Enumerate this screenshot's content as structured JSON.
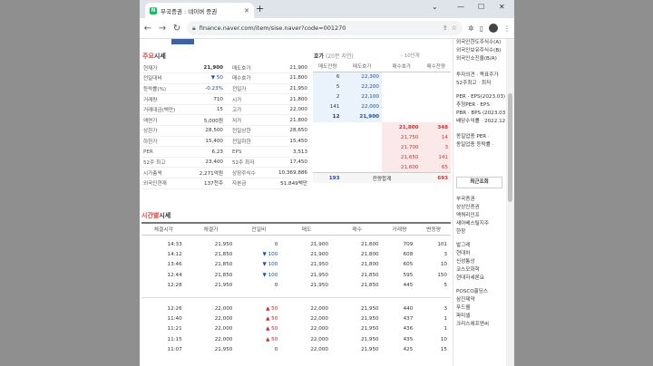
{
  "browser": {
    "tab_title": "부국증권 : 네이버 증권",
    "url": "finance.naver.com/item/sise.naver?code=001270"
  },
  "sise": {
    "title_accent": "주요",
    "title_rest": "시세",
    "rows": [
      {
        "l1": "현재가",
        "v1": "21,900",
        "l2": "매도호가",
        "v2": "21,900"
      },
      {
        "l1": "전일대비",
        "v1": "▼ 50",
        "l2": "매수호가",
        "v2": "21,800"
      },
      {
        "l1": "등락률(%)",
        "v1": "-0.23%",
        "l2": "전일가",
        "v2": "21,950"
      },
      {
        "l1": "거래량",
        "v1": "710",
        "l2": "시가",
        "v2": "21,800"
      },
      {
        "l1": "거래대금(백만)",
        "v1": "15",
        "l2": "고가",
        "v2": "22,000"
      },
      {
        "l1": "액면가",
        "v1": "5,000원",
        "l2": "저가",
        "v2": "21,800"
      },
      {
        "l1": "상한가",
        "v1": "28,500",
        "l2": "전일상한",
        "v2": "28,650"
      },
      {
        "l1": "하한가",
        "v1": "15,400",
        "l2": "전일하한",
        "v2": "15,450"
      },
      {
        "l1": "PER",
        "v1": "6.23",
        "l2": "EPS",
        "v2": "3,513"
      },
      {
        "l1": "52주 최고",
        "v1": "23,400",
        "l2": "52주 최저",
        "v2": "17,450"
      },
      {
        "l1": "시가총액",
        "v1": "2,271억원",
        "l2": "상장주식수",
        "v2": "10,369,886"
      },
      {
        "l1": "외국인현재",
        "v1": "137천주",
        "l2": "자본금",
        "v2": "51,849백만"
      }
    ]
  },
  "hoga": {
    "title": "호가",
    "subtitle": "(20분 지연)",
    "link": "› 10단계",
    "headers": [
      "매도잔량",
      "매도호가",
      "매수호가",
      "매수잔량"
    ],
    "sell": [
      {
        "qty": "6",
        "price": "22,300"
      },
      {
        "qty": "5",
        "price": "22,200"
      },
      {
        "qty": "2",
        "price": "22,100"
      },
      {
        "qty": "141",
        "price": "22,000"
      },
      {
        "qty": "12",
        "price": "21,900"
      }
    ],
    "buy": [
      {
        "price": "21,800",
        "qty": "348"
      },
      {
        "price": "21,750",
        "qty": "14"
      },
      {
        "price": "21,700",
        "qty": "3"
      },
      {
        "price": "21,650",
        "qty": "141"
      },
      {
        "price": "21,600",
        "qty": "65"
      }
    ],
    "total_sell": "193",
    "total_label": "잔량합계",
    "total_buy": "693"
  },
  "tick": {
    "title_accent": "시간별",
    "title_rest": "시세",
    "headers": [
      "체결시각",
      "체결가",
      "전일비",
      "매도",
      "매수",
      "거래량",
      "변동량"
    ],
    "group1": [
      {
        "time": "14:33",
        "price": "21,950",
        "chg": "0",
        "dir": "",
        "sell": "21,900",
        "buy": "21,800",
        "vol": "709",
        "delta": "101"
      },
      {
        "time": "14:12",
        "price": "21,850",
        "chg": "100",
        "dir": "dn",
        "sell": "21,900",
        "buy": "21,800",
        "vol": "608",
        "delta": "3"
      },
      {
        "time": "13:46",
        "price": "21,850",
        "chg": "100",
        "dir": "dn",
        "sell": "21,950",
        "buy": "21,800",
        "vol": "605",
        "delta": "10"
      },
      {
        "time": "12:44",
        "price": "21,850",
        "chg": "100",
        "dir": "dn",
        "sell": "21,950",
        "buy": "21,850",
        "vol": "595",
        "delta": "150"
      },
      {
        "time": "12:28",
        "price": "21,950",
        "chg": "0",
        "dir": "",
        "sell": "21,950",
        "buy": "21,850",
        "vol": "445",
        "delta": "5"
      }
    ],
    "group2": [
      {
        "time": "12:26",
        "price": "22,000",
        "chg": "50",
        "dir": "up",
        "sell": "22,000",
        "buy": "21,950",
        "vol": "440",
        "delta": "3"
      },
      {
        "time": "11:40",
        "price": "22,000",
        "chg": "50",
        "dir": "up",
        "sell": "22,000",
        "buy": "21,950",
        "vol": "437",
        "delta": "1"
      },
      {
        "time": "11:21",
        "price": "22,000",
        "chg": "50",
        "dir": "up",
        "sell": "22,000",
        "buy": "21,950",
        "vol": "436",
        "delta": "1"
      },
      {
        "time": "11:15",
        "price": "22,000",
        "chg": "50",
        "dir": "up",
        "sell": "22,000",
        "buy": "21,950",
        "vol": "435",
        "delta": "10"
      },
      {
        "time": "11:07",
        "price": "21,950",
        "chg": "0",
        "dir": "",
        "sell": "22,000",
        "buy": "21,950",
        "vol": "425",
        "delta": "15"
      }
    ]
  },
  "sidebar": {
    "top_items": [
      "외국인한도주식수(A)",
      "외국인보유주식수(B)",
      "외국인소진율(B/A)"
    ],
    "invest_items": [
      "투자의견 · 목표주가",
      "52주최고 · 최저"
    ],
    "per_items": [
      "PER · EPS(2023.03)",
      "추정PER · EPS",
      "PBR · BPS (2023.03)",
      "배당수익률 · 2022.12"
    ],
    "peer_items": [
      "동일업종 PER ·",
      "동일업종 등락률 ·"
    ],
    "recent_label": "최근조회",
    "recent1": [
      "부국증권",
      "상상인증권",
      "맥쿼리인프",
      "새아베스틸지주",
      "한창"
    ],
    "recent2": [
      "발그레",
      "현대차",
      "신성통상",
      "코스모화학",
      "현대자세론요"
    ],
    "recent3": [
      "POSCO홀딩스",
      "삼진제약",
      "푸드웰",
      "파미셀",
      "크리스에프앤씨"
    ]
  }
}
